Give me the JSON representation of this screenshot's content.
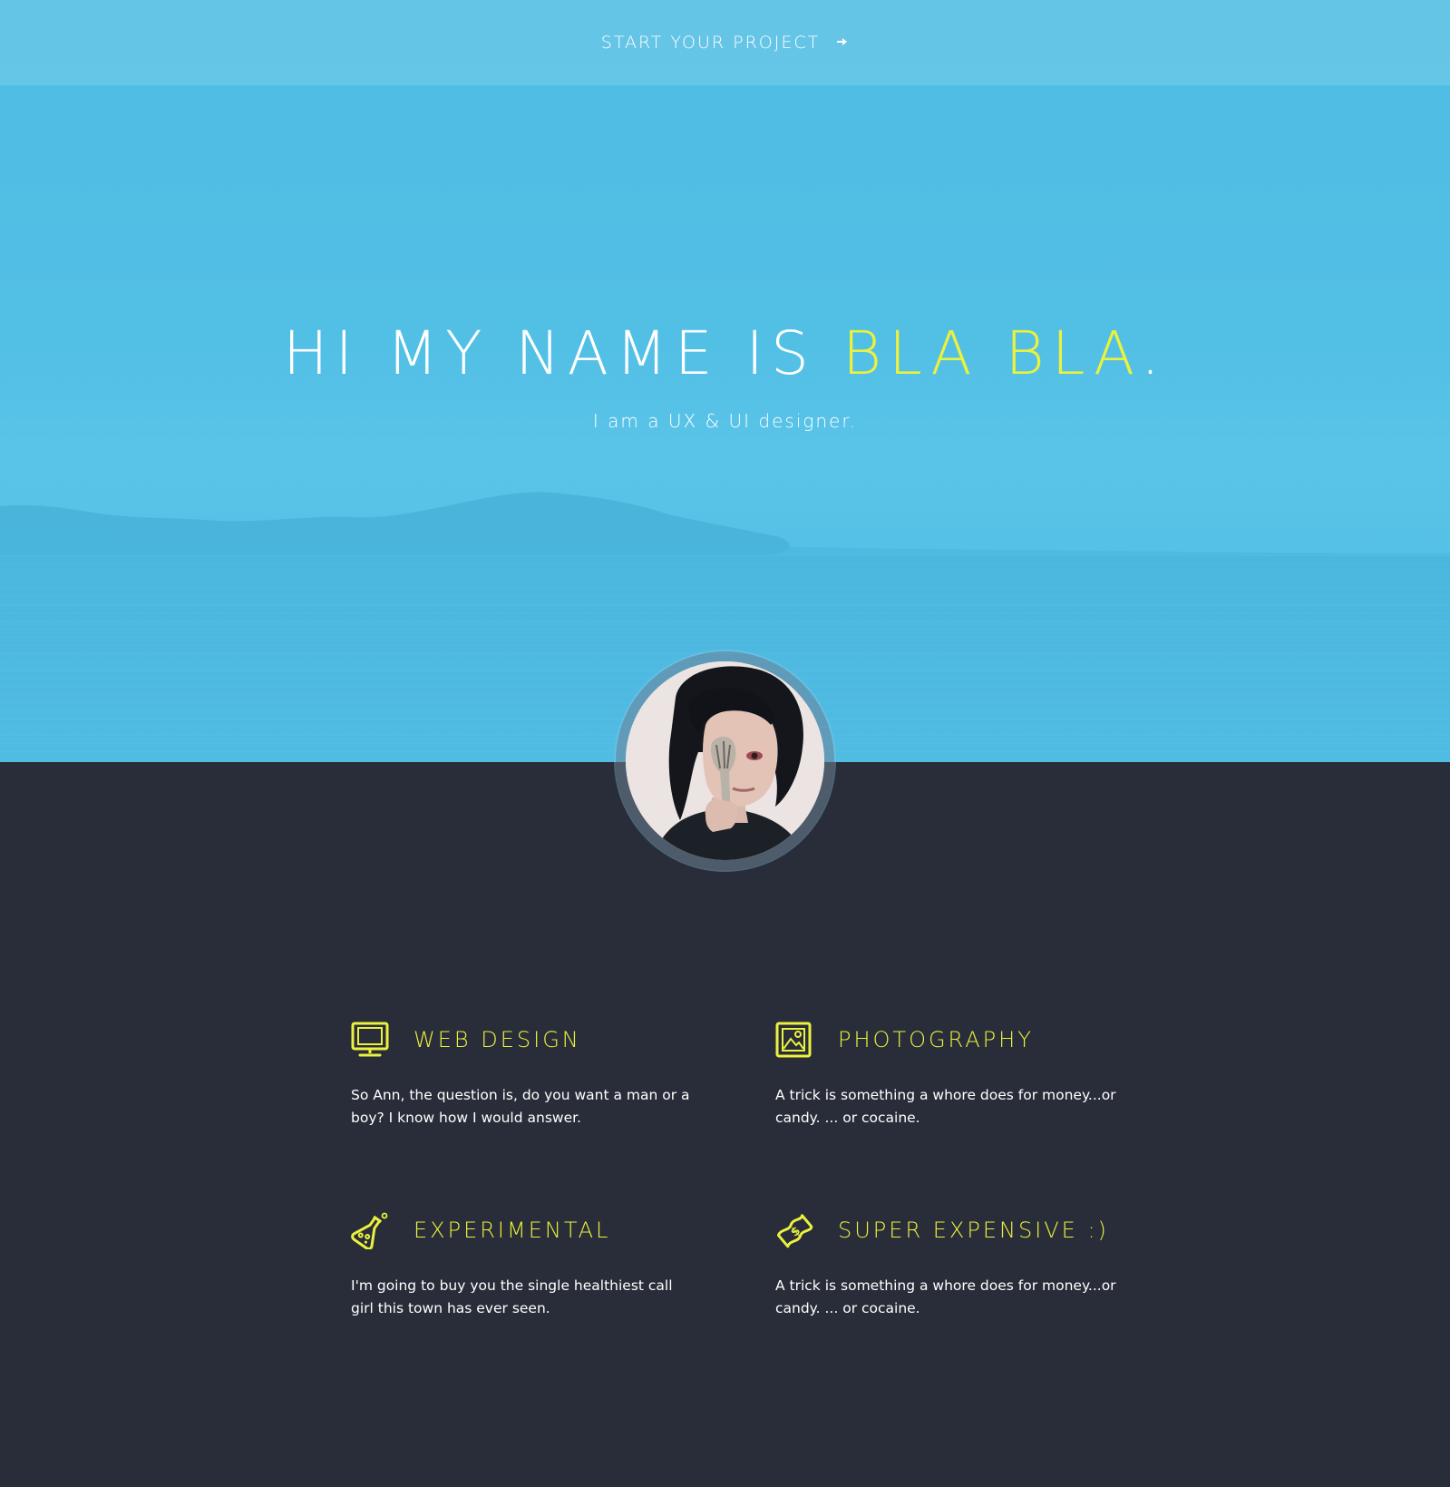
{
  "topbar": {
    "cta_label": "START YOUR PROJECT",
    "cta_icon": "arrow-right-icon"
  },
  "hero": {
    "title_main": "HI MY NAME IS ",
    "title_accent": "BLA BLA",
    "title_end": ".",
    "subtitle": "I am a UX & UI designer."
  },
  "avatar": {
    "icon": "avatar"
  },
  "services": [
    {
      "icon": "monitor-icon",
      "title": "WEB DESIGN",
      "text": "So Ann, the question is, do you want a man or a boy? I know how I would answer."
    },
    {
      "icon": "image-icon",
      "title": "PHOTOGRAPHY",
      "text": "A trick is something a whore does for money...or candy. ... or cocaine."
    },
    {
      "icon": "flask-icon",
      "title": "EXPERIMENTAL",
      "text": "I'm going to buy you the single healthiest call girl this town has ever seen."
    },
    {
      "icon": "money-icon",
      "title": "SUPER EXPENSIVE :)",
      "text": "A trick is something a whore does for money...or candy. ... or cocaine."
    }
  ],
  "colors": {
    "hero_blue": "#52bfe5",
    "accent_yellow": "#ecf13e",
    "dark_bg": "#282d39",
    "text_white": "#ffffff"
  }
}
